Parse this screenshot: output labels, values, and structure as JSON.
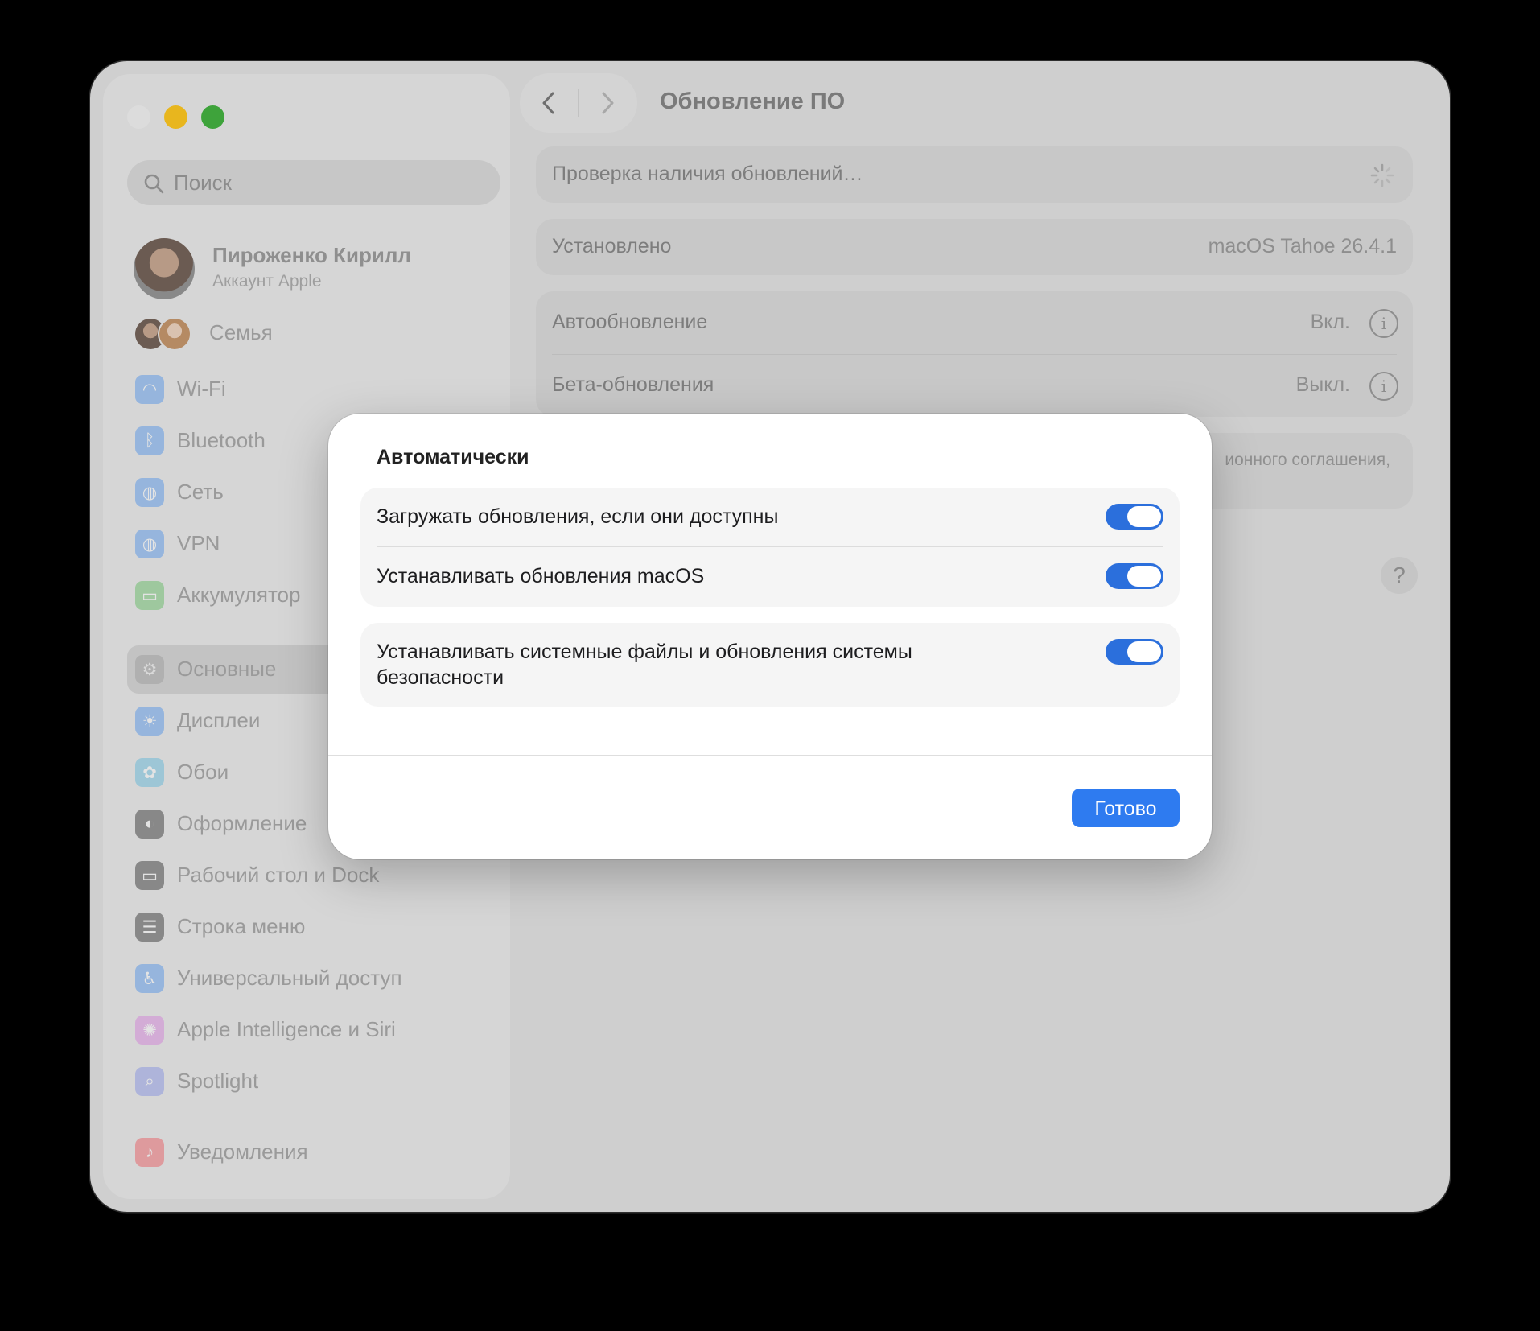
{
  "window": {
    "page_title": "Обновление ПО"
  },
  "sidebar": {
    "search_placeholder": "Поиск",
    "account": {
      "name": "Пироженко Кирилл",
      "subtitle": "Аккаунт Apple"
    },
    "family": {
      "label": "Семья"
    },
    "items": [
      {
        "label": "Wi-Fi",
        "icon": "wifi-icon",
        "color": "#4a8fe6"
      },
      {
        "label": "Bluetooth",
        "icon": "bluetooth-icon",
        "color": "#4a8fe6"
      },
      {
        "label": "Сеть",
        "icon": "globe-icon",
        "color": "#4a8fe6"
      },
      {
        "label": "VPN",
        "icon": "vpn-globe-icon",
        "color": "#4a8fe6"
      },
      {
        "label": "Аккумулятор",
        "icon": "battery-icon",
        "color": "#5bb85c"
      },
      {
        "label": "Основные",
        "icon": "gear-icon",
        "color": "#9a9a9a",
        "selected": true
      },
      {
        "label": "Дисплеи",
        "icon": "sun-icon",
        "color": "#4a8fe6"
      },
      {
        "label": "Обои",
        "icon": "flower-icon",
        "color": "#5ab4d6"
      },
      {
        "label": "Оформление",
        "icon": "appearance-icon",
        "color": "#2c2c2c"
      },
      {
        "label": "Рабочий стол и Dock",
        "icon": "dock-icon",
        "color": "#2c2c2c"
      },
      {
        "label": "Строка меню",
        "icon": "menubar-icon",
        "color": "#2c2c2c"
      },
      {
        "label": "Универсальный доступ",
        "icon": "accessibility-icon",
        "color": "#4a8fe6"
      },
      {
        "label": "Apple Intelligence и Siri",
        "icon": "siri-icon",
        "color": "#d07ad8"
      },
      {
        "label": "Spotlight",
        "icon": "magnifier-icon",
        "color": "#7f8cdf"
      },
      {
        "label": "Уведомления",
        "icon": "bell-icon",
        "color": "#e8535a"
      }
    ]
  },
  "main": {
    "checking": "Проверка наличия обновлений…",
    "installed": {
      "label": "Установлено",
      "value": "macOS Tahoe 26.4.1"
    },
    "auto_update": {
      "label": "Автообновление",
      "value": "Вкл."
    },
    "beta_update": {
      "label": "Бета-обновления",
      "value": "Выкл."
    },
    "license_fragment": "ионного соглашения,"
  },
  "dialog": {
    "title": "Автоматически",
    "options": [
      {
        "label": "Загружать обновления, если они доступны",
        "on": true
      },
      {
        "label": "Устанавливать обновления macOS",
        "on": true
      },
      {
        "label": "Устанавливать системные файлы и обновления системы безопасности",
        "on": true
      }
    ],
    "done_label": "Готово"
  }
}
